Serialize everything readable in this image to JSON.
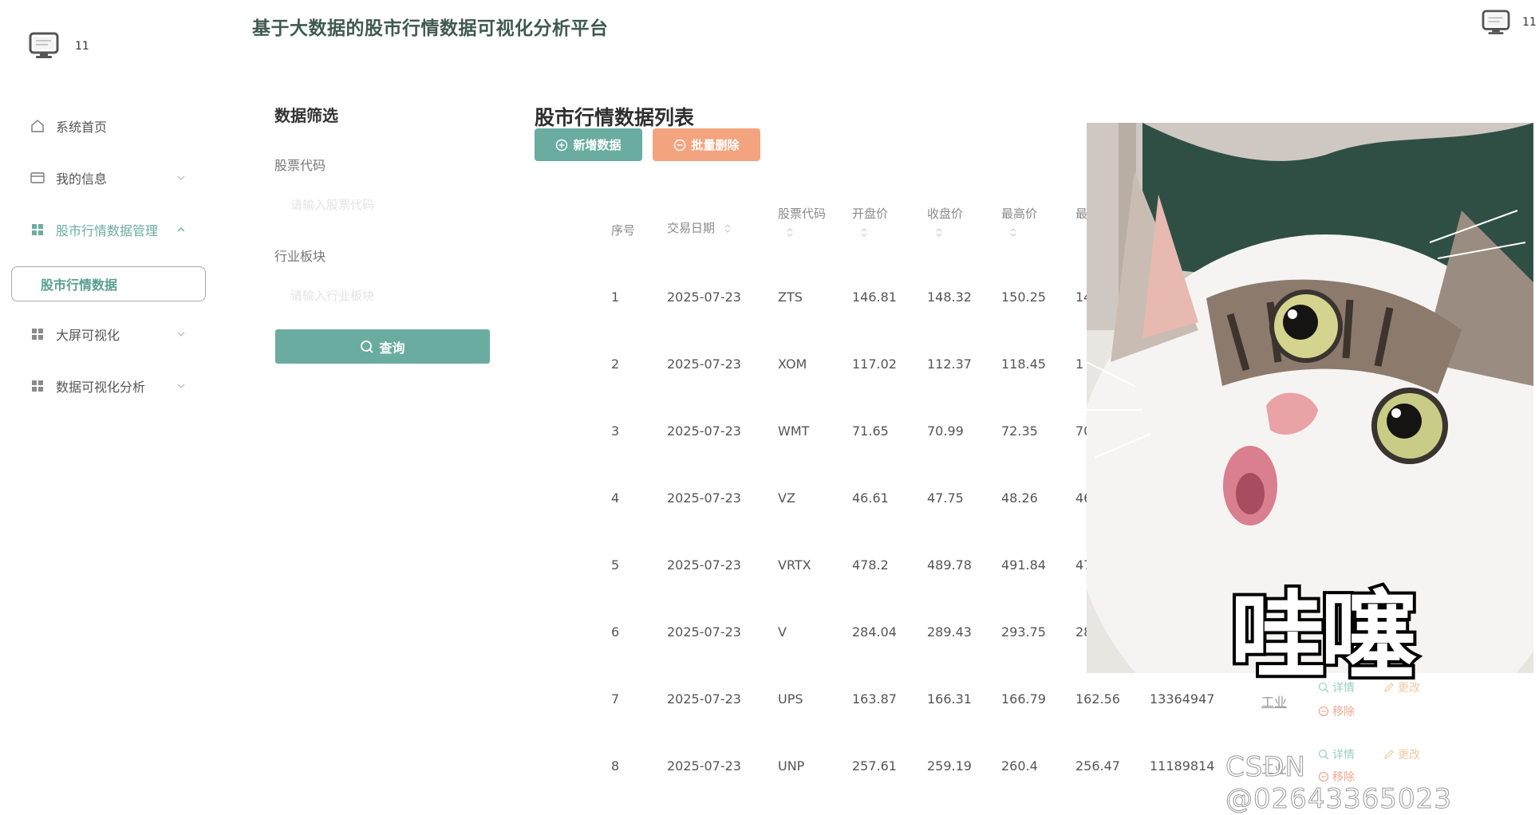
{
  "brand": {
    "user": "11"
  },
  "header": {
    "title": "基于大数据的股市行情数据可视化分析平台",
    "user": "11"
  },
  "sidebar": {
    "items": [
      {
        "label": "系统首页",
        "icon": "home-icon"
      },
      {
        "label": "我的信息",
        "icon": "card-icon"
      },
      {
        "label": "股市行情数据管理",
        "icon": "grid-icon"
      },
      {
        "label": "大屏可视化",
        "icon": "grid-icon"
      },
      {
        "label": "数据可视化分析",
        "icon": "grid-icon"
      }
    ],
    "active_sub": "股市行情数据"
  },
  "filter": {
    "title": "数据筛选",
    "code_label": "股票代码",
    "code_placeholder": "请输入股票代码",
    "sector_label": "行业板块",
    "sector_placeholder": "请输入行业板块",
    "search_label": "查询"
  },
  "list": {
    "title": "股市行情数据列表",
    "add_label": "新增数据",
    "del_label": "批量删除",
    "headers": [
      "序号",
      "交易日期",
      "股票代码",
      "开盘价",
      "收盘价",
      "最高价",
      "最"
    ],
    "rows": [
      {
        "no": "1",
        "date": "2025-07-23",
        "code": "ZTS",
        "open": "146.81",
        "close": "148.32",
        "high": "150.25",
        "low": "14"
      },
      {
        "no": "2",
        "date": "2025-07-23",
        "code": "XOM",
        "open": "117.02",
        "close": "112.37",
        "high": "118.45",
        "low": "1"
      },
      {
        "no": "3",
        "date": "2025-07-23",
        "code": "WMT",
        "open": "71.65",
        "close": "70.99",
        "high": "72.35",
        "low": "70"
      },
      {
        "no": "4",
        "date": "2025-07-23",
        "code": "VZ",
        "open": "46.61",
        "close": "47.75",
        "high": "48.26",
        "low": "46"
      },
      {
        "no": "5",
        "date": "2025-07-23",
        "code": "VRTX",
        "open": "478.2",
        "close": "489.78",
        "high": "491.84",
        "low": "47"
      },
      {
        "no": "6",
        "date": "2025-07-23",
        "code": "V",
        "open": "284.04",
        "close": "289.43",
        "high": "293.75",
        "low": "28"
      },
      {
        "no": "7",
        "date": "2025-07-23",
        "code": "UPS",
        "open": "163.87",
        "close": "166.31",
        "high": "166.79",
        "low": "162.56",
        "volume": "13364947",
        "sector": "工业"
      },
      {
        "no": "8",
        "date": "2025-07-23",
        "code": "UNP",
        "open": "257.61",
        "close": "259.19",
        "high": "260.4",
        "low": "256.47",
        "volume": "11189814",
        "sector": "工业"
      }
    ],
    "actions": {
      "detail": "详情",
      "edit": "更改",
      "remove": "移除"
    }
  },
  "overlay": {
    "sticker_text": "哇噻",
    "watermark": "CSDN @02643365023"
  },
  "colors": {
    "primary": "#6aada0",
    "danger": "#f3a47f",
    "title": "#3f5a50"
  }
}
